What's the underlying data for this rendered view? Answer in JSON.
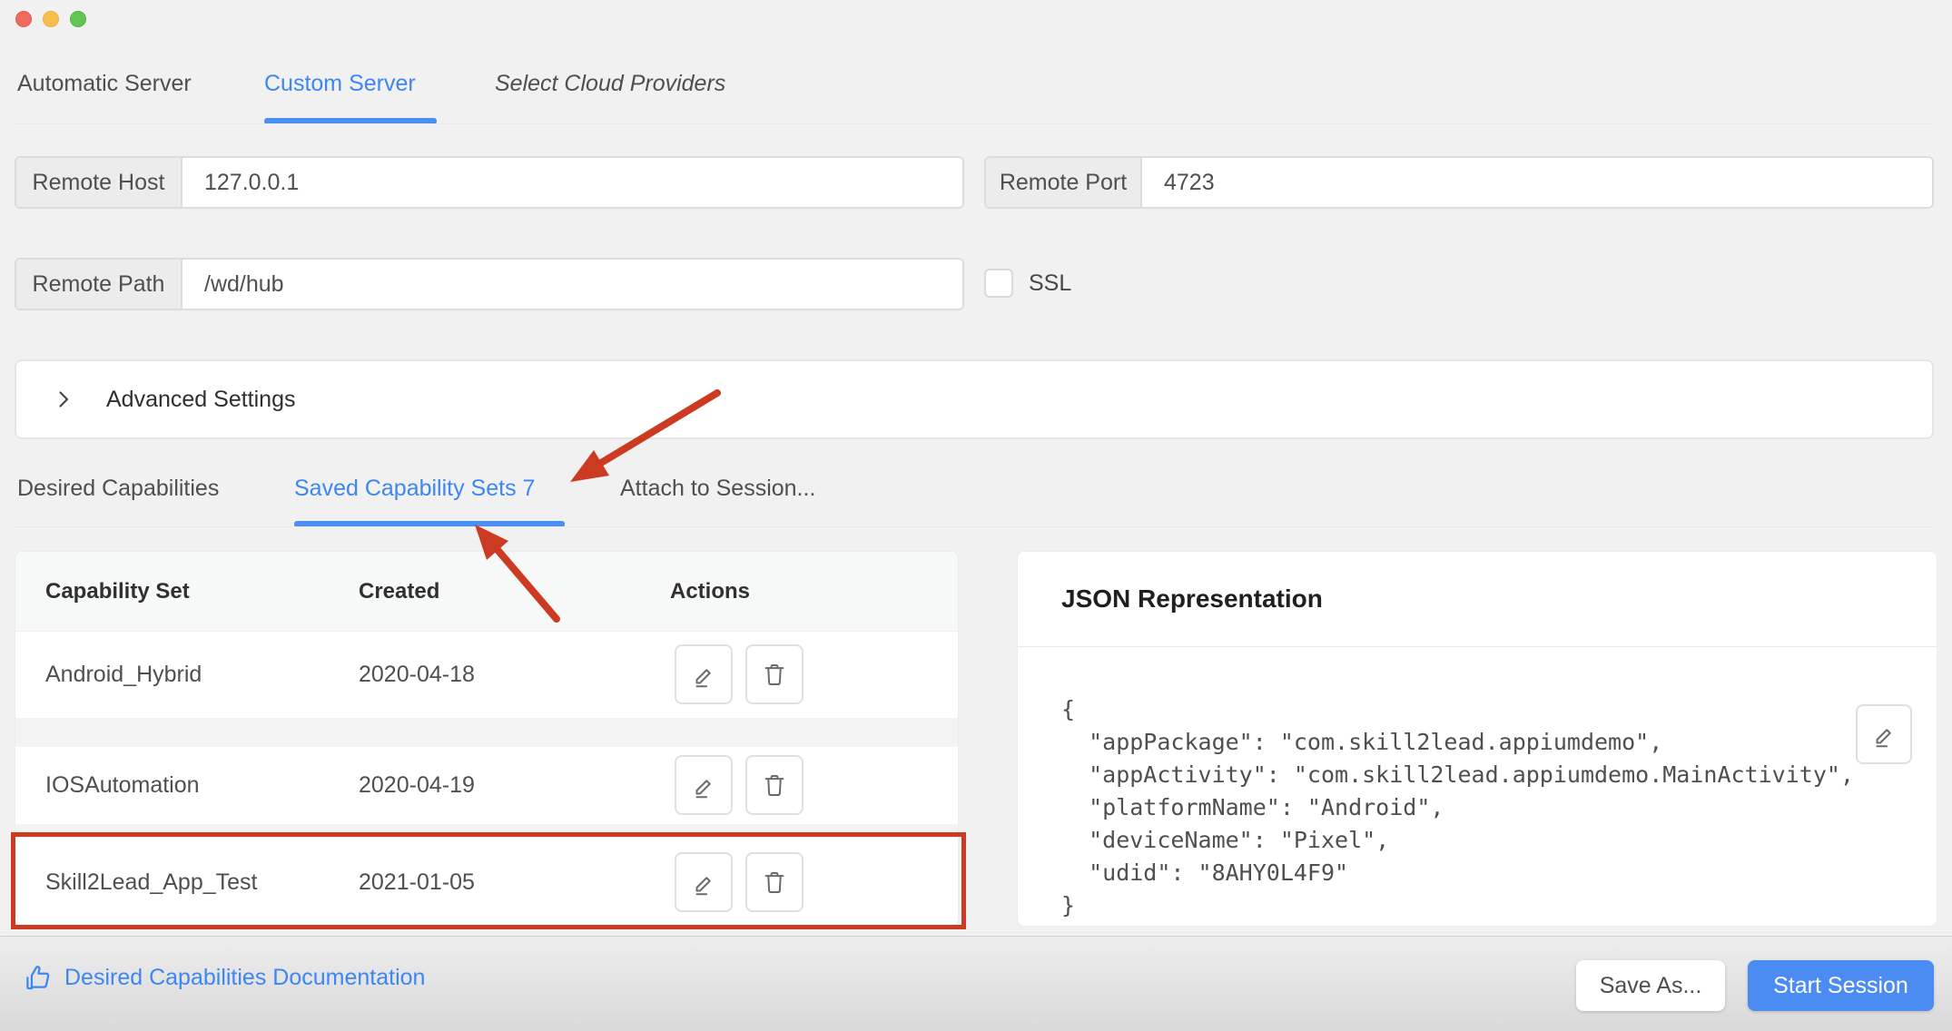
{
  "window": {
    "controls": {
      "close": "close",
      "minimize": "minimize",
      "zoom": "zoom"
    }
  },
  "server_tabs": {
    "items": [
      {
        "label": "Automatic Server",
        "active": false
      },
      {
        "label": "Custom Server",
        "active": true
      },
      {
        "label": "Select Cloud Providers",
        "active": false
      }
    ]
  },
  "form": {
    "remote_host": {
      "label": "Remote Host",
      "value": "127.0.0.1"
    },
    "remote_port": {
      "label": "Remote Port",
      "value": "4723"
    },
    "remote_path": {
      "label": "Remote Path",
      "value": "/wd/hub"
    },
    "ssl": {
      "label": "SSL",
      "checked": false
    },
    "advanced": {
      "label": "Advanced Settings",
      "expanded": false
    }
  },
  "capability_tabs": {
    "items": [
      {
        "label": "Desired Capabilities",
        "active": false
      },
      {
        "label": "Saved Capability Sets 7",
        "active": true
      },
      {
        "label": "Attach to Session...",
        "active": false
      }
    ]
  },
  "saved_sets": {
    "columns": [
      "Capability Set",
      "Created",
      "Actions"
    ],
    "rows": [
      {
        "name": "Android_Hybrid",
        "created": "2020-04-18"
      },
      {
        "name": "IOSAutomation",
        "created": "2020-04-19"
      },
      {
        "name": "Skill2Lead_App_Test",
        "created": "2021-01-05",
        "highlighted": true
      }
    ]
  },
  "json_panel": {
    "title": "JSON Representation",
    "lines": [
      "{",
      "  \"appPackage\": \"com.skill2lead.appiumdemo\",",
      "  \"appActivity\": \"com.skill2lead.appiumdemo.MainActivity\",",
      "  \"platformName\": \"Android\",",
      "  \"deviceName\": \"Pixel\",",
      "  \"udid\": \"8AHY0L4F9\"",
      "}"
    ]
  },
  "footer": {
    "doc_link": "Desired Capabilities Documentation",
    "save_as": "Save As...",
    "start_session": "Start Session"
  },
  "colors": {
    "accent_blue": "#3e86f3",
    "button_blue": "#4a8cf2",
    "annotation_red": "#cc3a22",
    "page_bg": "#f1f1f2"
  }
}
